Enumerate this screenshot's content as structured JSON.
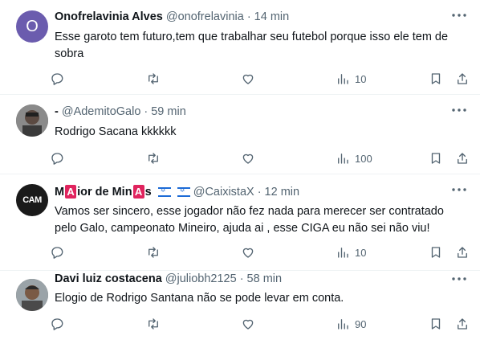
{
  "replies": [
    {
      "name": "Onofrelavinia Alves",
      "handle": "@onofrelavinia",
      "sep": "·",
      "time": "14 min",
      "avatar_letter": "O",
      "text": "Esse garoto tem futuro,tem que trabalhar seu futebol porque isso ele tem de sobra",
      "views": "10"
    },
    {
      "name": "-",
      "handle": "@AdemitoGalo",
      "sep": "·",
      "time": "59 min",
      "text": "Rodrigo Sacana  kkkkkk",
      "views": "100"
    },
    {
      "name_parts": [
        "M",
        "A",
        "ior de Min",
        "A",
        "s"
      ],
      "handle": "@CaixistaX",
      "sep": "·",
      "time": "12 min",
      "avatar_text": "CAM",
      "text": "Vamos ser sincero, esse jogador não fez nada para merecer ser contratado pelo Galo, campeonato Mineiro, ajuda ai , esse CIGA eu não sei não viu!",
      "views": "10"
    },
    {
      "name": "Davi luiz costacena",
      "handle": "@juliobh2125",
      "sep": "·",
      "time": "58 min",
      "text": "Elogio de Rodrigo Santana não se pode levar em conta.",
      "views": "90"
    }
  ],
  "icons": {
    "more": "more-icon",
    "reply": "reply-icon",
    "retweet": "retweet-icon",
    "like": "heart-icon",
    "views": "views-icon",
    "bookmark": "bookmark-icon",
    "share": "share-icon"
  },
  "colors": {
    "avatar_letter_bg": "#6b5cae",
    "name_badge": "#e0245e",
    "muted": "#536471",
    "divider": "#eff3f4"
  }
}
